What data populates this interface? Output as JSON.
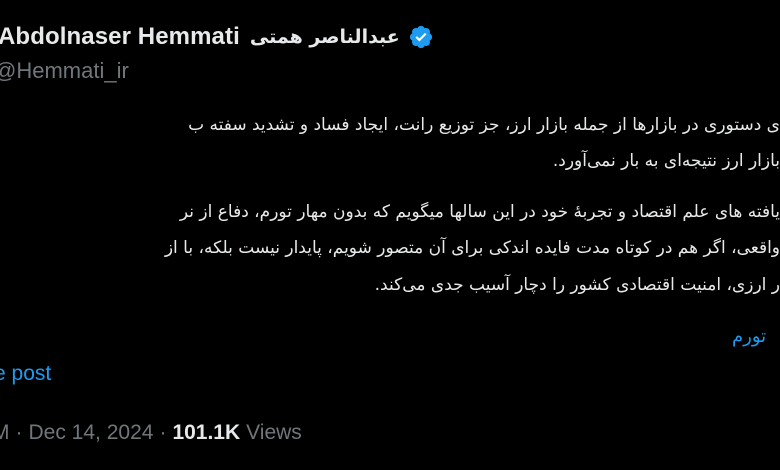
{
  "author": {
    "display_name": "Abdolnaser Hemmati",
    "display_name_fa": "عبدالناصر همتی",
    "verified_icon": "verified-badge-icon",
    "handle": "@Hemmati_ir"
  },
  "tweet": {
    "lines": [
      "ی دستوری در بازارها از جمله بازار ارز، جز توزیع رانت، ایجاد فساد و تشدید سفته ب",
      "بازار ارز نتیجه‌ای به بار نمی‌آورد.",
      "یافته های علم اقتصاد و تجربهٔ خود در این سالها میگویم که بدون مهار تورم، دفاع از نر",
      "واقعی، اگر هم در کوتاه مدت فایده اندکی برای آن متصور شویم، پایدار نیست بلکه، با از",
      "ر ارزی، امنیت اقتصادی کشور را دچار آسیب جدی می‌کند."
    ],
    "hashtag": "تورم",
    "translate_label": "e post"
  },
  "meta": {
    "time_fragment": "M",
    "separator": "·",
    "date": "Dec 14, 2024",
    "views_count": "101.1K",
    "views_label": "Views"
  },
  "colors": {
    "background": "#000000",
    "text_primary": "#e7e9ea",
    "text_secondary": "#71767b",
    "link": "#1d9bf0",
    "verified": "#1d9bf0"
  }
}
